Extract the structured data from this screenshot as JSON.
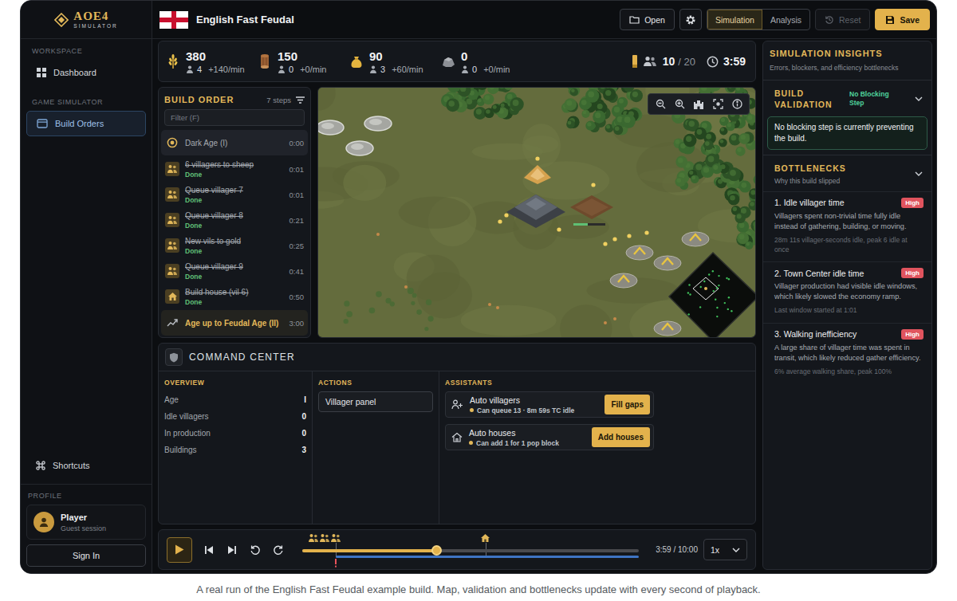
{
  "brand": {
    "title": "AOE4",
    "subtitle": "SIMULATOR"
  },
  "sidebar": {
    "sections": [
      {
        "label": "WORKSPACE",
        "items": [
          {
            "label": "Dashboard",
            "selected": false,
            "kind": "dashboard"
          }
        ]
      },
      {
        "label": "GAME SIMULATOR",
        "items": [
          {
            "label": "Build Orders",
            "selected": true,
            "kind": "build-orders"
          }
        ]
      }
    ],
    "shortcuts": "Shortcuts",
    "profile": {
      "label": "PROFILE",
      "name": "Player",
      "session": "Guest session"
    },
    "sign_in": "Sign In"
  },
  "header": {
    "title": "English Fast Feudal",
    "open": "Open",
    "modes": [
      {
        "label": "Simulation",
        "selected": true
      },
      {
        "label": "Analysis",
        "selected": false
      }
    ],
    "reset": {
      "label": "Reset",
      "disabled": true
    },
    "save": "Save"
  },
  "resources": [
    {
      "kind": "food",
      "amount": "380",
      "workers": "4",
      "rate": "+140/min"
    },
    {
      "kind": "wood",
      "amount": "150",
      "workers": "0",
      "rate": "+0/min"
    },
    {
      "kind": "gold",
      "amount": "90",
      "workers": "3",
      "rate": "+60/min"
    },
    {
      "kind": "stone",
      "amount": "0",
      "workers": "0",
      "rate": "+0/min"
    }
  ],
  "population": {
    "current": "10",
    "max": "/ 20"
  },
  "clock": "3:59",
  "build_order": {
    "title": "BUILD ORDER",
    "count": "7 steps",
    "filter_placeholder": "Filter (F)",
    "steps": [
      {
        "kind": "dark-age",
        "label": "Dark Age (I)",
        "time": "0:00",
        "done": false,
        "current": false
      },
      {
        "kind": "villager",
        "label": "6 villagers to sheep",
        "time": "0:01",
        "status": "Done",
        "done": true,
        "current": false
      },
      {
        "kind": "villager",
        "label": "Queue villager 7",
        "time": "0:01",
        "status": "Done",
        "done": true,
        "current": false
      },
      {
        "kind": "villager",
        "label": "Queue villager 8",
        "time": "0:21",
        "status": "Done",
        "done": true,
        "current": false
      },
      {
        "kind": "villager",
        "label": "New vils to gold",
        "time": "0:25",
        "status": "Done",
        "done": true,
        "current": false
      },
      {
        "kind": "villager",
        "label": "Queue villager 9",
        "time": "0:41",
        "status": "Done",
        "done": true,
        "current": false
      },
      {
        "kind": "house",
        "label": "Build house (vil 6)",
        "time": "0:50",
        "status": "Done",
        "done": true,
        "current": false
      },
      {
        "kind": "feudal-age",
        "label": "Age up to Feudal Age (II)",
        "time": "3:00",
        "done": false,
        "current": true
      }
    ]
  },
  "command_center": {
    "title": "COMMAND CENTER",
    "overview": {
      "label": "OVERVIEW",
      "rows": [
        {
          "label": "Age",
          "value": "I"
        },
        {
          "label": "Idle villagers",
          "value": "0"
        },
        {
          "label": "In production",
          "value": "0"
        },
        {
          "label": "Buildings",
          "value": "3"
        }
      ]
    },
    "actions": {
      "label": "ACTIONS",
      "buttons": [
        "Villager panel"
      ]
    },
    "assistants": {
      "label": "ASSISTANTS",
      "items": [
        {
          "kind": "villagers",
          "title": "Auto villagers",
          "detail": "Can queue 13 · 8m 59s TC idle",
          "button": "Fill gaps"
        },
        {
          "kind": "houses",
          "title": "Auto houses",
          "detail": "Can add 1 for 1 pop block",
          "button": "Add houses"
        }
      ]
    }
  },
  "playback": {
    "playing": false,
    "level": 0.397,
    "simulated_level": 0.9,
    "time": "3:59 / 10:00",
    "speed": "1x",
    "markers": [
      {
        "kind": "villager",
        "level": 0.033
      },
      {
        "kind": "villager",
        "level": 0.066
      },
      {
        "kind": "villager",
        "level": 0.1
      },
      {
        "kind": "house",
        "level": 0.544
      },
      {
        "kind": "warning",
        "level": 0.1
      }
    ]
  },
  "insights": {
    "title": "SIMULATION INSIGHTS",
    "subtitle": "Errors, blockers, and efficiency bottlenecks",
    "validation": {
      "title": "BUILD VALIDATION",
      "badge": "No Blocking Step",
      "expanded": true,
      "message": "No blocking step is currently preventing the build."
    },
    "bottlenecks": {
      "title": "BOTTLENECKS",
      "subtitle": "Why this build slipped",
      "expanded": true,
      "items": [
        {
          "title": "1. Idle villager time",
          "severity": "High",
          "description": "Villagers spent non-trivial time fully idle instead of gathering, building, or moving.",
          "meta": "28m 11s villager-seconds idle, peak 6 idle at once"
        },
        {
          "title": "2. Town Center idle time",
          "severity": "High",
          "description": "Villager production had visible idle windows, which likely slowed the economy ramp.",
          "meta": "Last window started at 1:01"
        },
        {
          "title": "3. Walking inefficiency",
          "severity": "High",
          "description": "A large share of villager time was spent in transit, which likely reduced gather efficiency.",
          "meta": "6% average walking share, peak 100%"
        }
      ]
    }
  },
  "caption": "A real run of the English Fast Feudal example build. Map, validation and bottlenecks update with every second of playback."
}
